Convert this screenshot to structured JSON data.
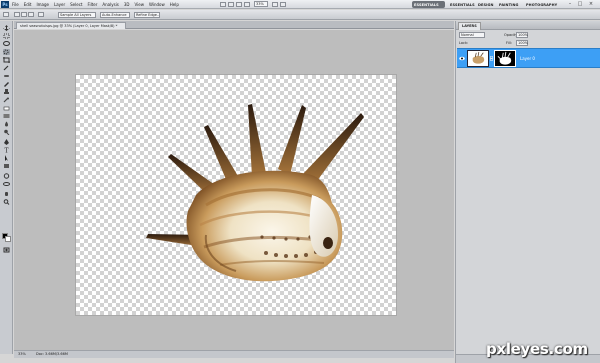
{
  "app": {
    "logo": "Ps"
  },
  "menu": {
    "items": [
      "File",
      "Edit",
      "Image",
      "Layer",
      "Select",
      "Filter",
      "Analysis",
      "3D",
      "View",
      "Window",
      "Help"
    ],
    "zoom": "33%"
  },
  "workspaces": {
    "active": "ESSENTIALS",
    "items": [
      "ESSENTIALS",
      "DESIGN",
      "PAINTING",
      "PHOTOGRAPHY"
    ]
  },
  "options": {
    "sample_label": "Sample All Layers",
    "enhance_label": "Auto-Enhance",
    "refine_label": "Refine Edge..."
  },
  "document": {
    "tab_title": "shell seasnotuisps.jpg @ 33% (Layer 0, Layer Mask/8) *",
    "zoom": "33%",
    "info": "Doc: 3.66M/3.66M"
  },
  "layers": {
    "panel_title": "LAYERS",
    "blend_mode": "Normal",
    "opacity_label": "Opacity:",
    "opacity": "100%",
    "lock_label": "Lock:",
    "fill_label": "Fill:",
    "fill": "100%",
    "layer_name": "Layer 0"
  },
  "colors": {
    "selection": "#3d9ff5",
    "foreground": "#000000",
    "background": "#ffffff",
    "workspace_active": "#6b7077"
  },
  "watermark": "pxleyes.com"
}
